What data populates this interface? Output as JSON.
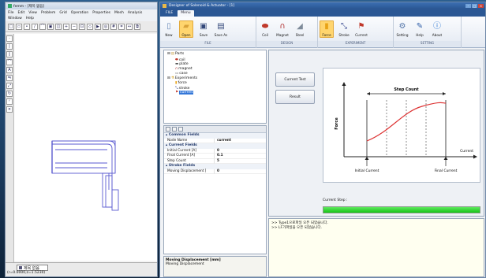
{
  "left_window": {
    "title": "femm - [제목 없음]",
    "menu": [
      "File",
      "Edit",
      "View",
      "Problem",
      "Grid",
      "Operation",
      "Properties",
      "Mesh",
      "Analysis"
    ],
    "menu2": [
      "Window",
      "Help"
    ],
    "tab_label": "제목 없음",
    "coord_text": "(r=0.0000,z=1.5230)"
  },
  "main_window": {
    "title": "Designer of Solenoid & Actuator - [1]",
    "ribbon_tabs": [
      "FILE",
      "Menu"
    ],
    "ribbon_groups": [
      {
        "label": "FILE",
        "buttons": [
          {
            "label": "New",
            "icon": "new-file-icon"
          },
          {
            "label": "Open",
            "icon": "open-folder-icon"
          },
          {
            "label": "Save",
            "icon": "save-icon"
          },
          {
            "label": "Save As",
            "icon": "save-as-icon"
          }
        ]
      },
      {
        "label": "DESIGN",
        "buttons": [
          {
            "label": "Coil",
            "icon": "coil-icon"
          },
          {
            "label": "Magnet",
            "icon": "magnet-icon"
          },
          {
            "label": "Steel",
            "icon": "steel-icon"
          }
        ]
      },
      {
        "label": "EXPERIMENT",
        "buttons": [
          {
            "label": "Force",
            "icon": "force-icon"
          },
          {
            "label": "Stroke",
            "icon": "stroke-icon"
          },
          {
            "label": "Current",
            "icon": "current-icon"
          }
        ]
      },
      {
        "label": "SETTING",
        "buttons": [
          {
            "label": "Setting",
            "icon": "setting-icon"
          },
          {
            "label": "Help",
            "icon": "help-icon"
          },
          {
            "label": "About",
            "icon": "about-icon"
          }
        ]
      }
    ],
    "tree": {
      "parts_label": "Parts",
      "parts": [
        "coil",
        "plate",
        "magnet",
        "case"
      ],
      "experiments_label": "Experiments",
      "experiments": [
        "force",
        "stroke",
        "current"
      ],
      "selected": "current"
    },
    "properties": {
      "categories": [
        {
          "name": "Common Fields",
          "rows": [
            {
              "k": "Node Name",
              "v": "current"
            }
          ]
        },
        {
          "name": "Current Fields",
          "rows": [
            {
              "k": "Initial Current [A]",
              "v": "0"
            },
            {
              "k": "Final Current [A]",
              "v": "0.1"
            },
            {
              "k": "Step Count",
              "v": "5"
            }
          ]
        },
        {
          "name": "Stroke Fields",
          "rows": [
            {
              "k": "Moving Displacement [",
              "v": "0"
            }
          ]
        }
      ]
    },
    "description": {
      "title": "Moving Displacement [mm]",
      "text": "Moving Displacement"
    },
    "buttons": {
      "current_test": "Current Test",
      "result": "Result"
    },
    "chart_labels": {
      "step_count": "Step Count",
      "force": "Force",
      "current": "Current",
      "initial_current": "Initial Current",
      "final_current": "Final Current"
    },
    "step_label": "Current Step :",
    "progress": 1.0,
    "log_lines": [
      ">> Type1으로파일 오픈 되었습니다.",
      ">> LF가파일을 오픈 되었습니다."
    ]
  }
}
